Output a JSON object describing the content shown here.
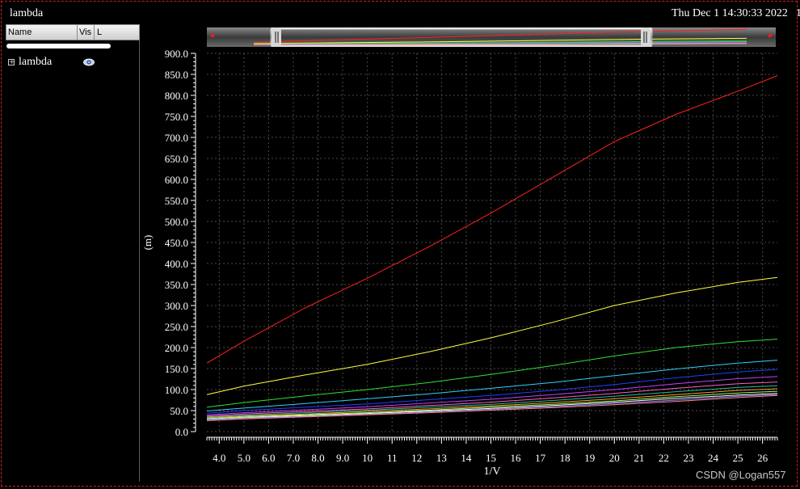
{
  "window": {
    "title": "lambda",
    "datetime": "Thu Dec 1 14:30:33 2022",
    "datetime_extra": "1"
  },
  "sidebar": {
    "columns": [
      "Name",
      "Vis",
      "L"
    ],
    "items": [
      {
        "label": "lambda",
        "expand_icon": "plus-box-icon",
        "visibility_icon": "eye-icon"
      }
    ]
  },
  "watermark": "CSDN @Logan557",
  "colors": {
    "background": "#000000",
    "grid": "#4a4a4a",
    "axis": "#ffffff"
  },
  "chart_data": {
    "type": "line",
    "title": "",
    "xlabel": "1/V",
    "ylabel": "(m)",
    "xlim": [
      3.5,
      26.6
    ],
    "ylim": [
      0,
      900
    ],
    "x_ticks": [
      "4.0",
      "5.0",
      "6.0",
      "7.0",
      "8.0",
      "9.0",
      "10",
      "11",
      "12",
      "13",
      "14",
      "15",
      "16",
      "17",
      "18",
      "19",
      "20",
      "21",
      "22",
      "23",
      "24",
      "25",
      "26"
    ],
    "y_ticks": [
      "0.0",
      "50.0",
      "100.0",
      "150.0",
      "200.0",
      "250.0",
      "300.0",
      "350.0",
      "400.0",
      "450.0",
      "500.0",
      "550.0",
      "600.0",
      "650.0",
      "700.0",
      "750.0",
      "800.0",
      "850.0",
      "900.0"
    ],
    "grid": true,
    "legend": "none",
    "x": [
      3.5,
      5,
      7.5,
      10,
      12.5,
      15,
      17.5,
      20,
      22.5,
      25,
      26.6
    ],
    "series": [
      {
        "color": "#ff2020",
        "values": [
          163,
          215,
          295,
          365,
          440,
          520,
          605,
          690,
          755,
          810,
          847
        ]
      },
      {
        "color": "#ffff40",
        "values": [
          88,
          108,
          135,
          160,
          190,
          223,
          260,
          300,
          330,
          355,
          367
        ]
      },
      {
        "color": "#30e030",
        "values": [
          58,
          69,
          85,
          100,
          117,
          136,
          157,
          180,
          200,
          214,
          220
        ]
      },
      {
        "color": "#30d0ff",
        "values": [
          49,
          56,
          67,
          78,
          90,
          103,
          117,
          133,
          149,
          163,
          170
        ]
      },
      {
        "color": "#2040ff",
        "values": [
          44,
          50,
          58,
          66,
          76,
          86,
          98,
          112,
          128,
          142,
          148
        ]
      },
      {
        "color": "#c040ff",
        "values": [
          40,
          45,
          52,
          59,
          68,
          77,
          88,
          100,
          114,
          126,
          131
        ]
      },
      {
        "color": "#ff60c0",
        "values": [
          37,
          42,
          48,
          54,
          62,
          70,
          80,
          91,
          103,
          114,
          118
        ]
      },
      {
        "color": "#20c0a0",
        "values": [
          35,
          39,
          45,
          51,
          58,
          65,
          74,
          84,
          95,
          105,
          109
        ]
      },
      {
        "color": "#ffa030",
        "values": [
          33,
          37,
          42,
          48,
          54,
          61,
          69,
          78,
          88,
          98,
          102
        ]
      },
      {
        "color": "#a0ff60",
        "values": [
          31,
          35,
          40,
          45,
          51,
          58,
          65,
          73,
          83,
          92,
          96
        ]
      },
      {
        "color": "#ffffff",
        "values": [
          29,
          33,
          38,
          43,
          49,
          55,
          62,
          70,
          79,
          87,
          91
        ]
      },
      {
        "color": "#8080ff",
        "values": [
          28,
          32,
          36,
          41,
          47,
          53,
          59,
          67,
          75,
          84,
          88
        ]
      },
      {
        "color": "#ff8080",
        "values": [
          26,
          30,
          35,
          40,
          45,
          51,
          57,
          64,
          72,
          81,
          86
        ]
      }
    ]
  }
}
